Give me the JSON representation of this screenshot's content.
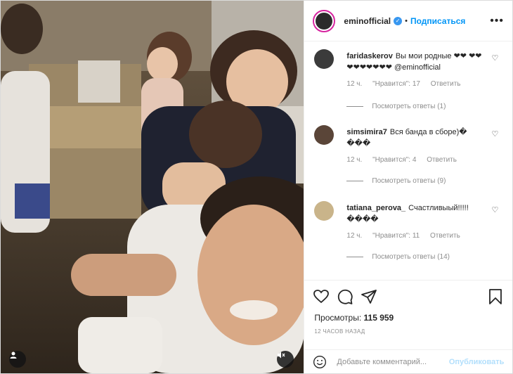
{
  "post": {
    "username": "eminofficial",
    "verified_icon": "verified-badge-icon",
    "separator": "•",
    "follow_label": "Подписаться",
    "more_label": "•••"
  },
  "comments": [
    {
      "username": "faridaskerov",
      "text": "Вы мои родные ❤❤ ❤❤❤❤❤❤❤❤❤ @eminofficial",
      "time": "12 ч.",
      "likes": "\"Нравится\": 17",
      "reply": "Ответить",
      "view_replies": "Посмотреть ответы (1)",
      "avatar_color": "#3b3b3b"
    },
    {
      "username": "simsimira7",
      "text": "Вся банда в сборе)� ���",
      "time": "12 ч.",
      "likes": "\"Нравится\": 4",
      "reply": "Ответить",
      "view_replies": "Посмотреть ответы (9)",
      "avatar_color": "#5a4538"
    },
    {
      "username": "tatiana_perova_",
      "text": "Счастливыый!!!!! ����",
      "time": "12 ч.",
      "likes": "\"Нравится\": 11",
      "reply": "Ответить",
      "view_replies": "Посмотреть ответы (14)",
      "avatar_color": "#c9b48a"
    }
  ],
  "actions": {
    "icons": [
      "heart-icon",
      "comment-icon",
      "share-icon",
      "bookmark-icon"
    ]
  },
  "stats": {
    "views_label": "Просмотры:",
    "views_count": "115 959",
    "time_ago": "12 ЧАСОВ НАЗАД"
  },
  "add_comment": {
    "placeholder": "Добавьте комментарий...",
    "publish_label": "Опубликовать"
  },
  "colors": {
    "accent": "#0095f6",
    "publish_disabled": "#b2dffc",
    "muted": "#8e8e8e"
  }
}
